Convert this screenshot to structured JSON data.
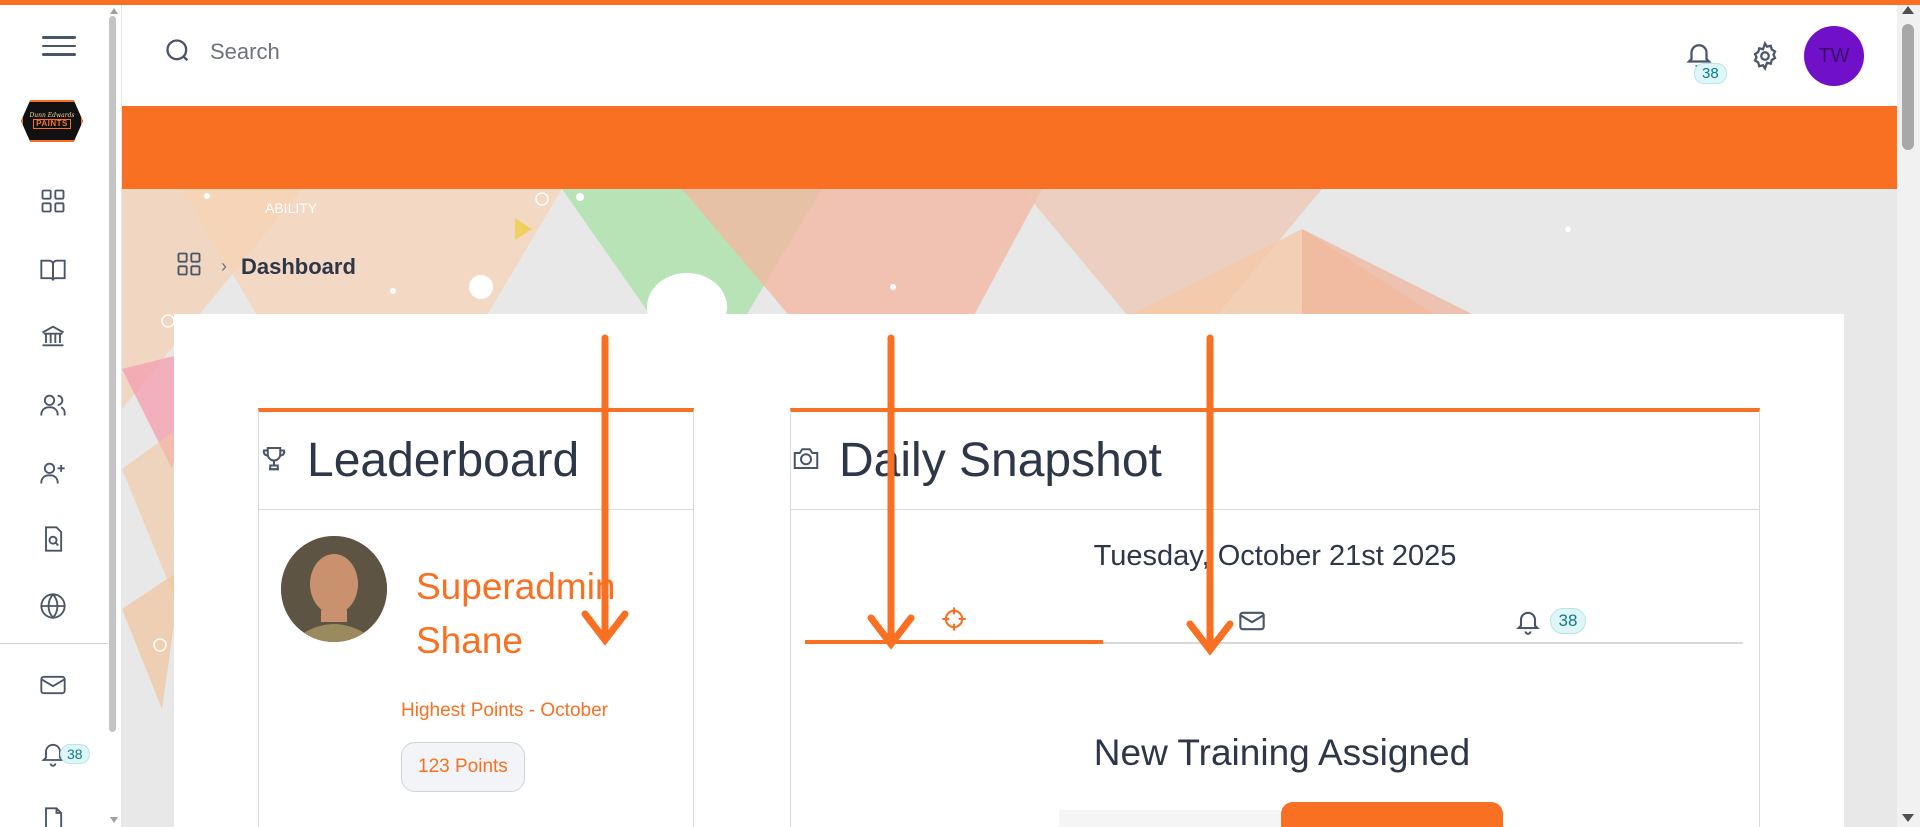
{
  "header": {
    "search_placeholder": "Search",
    "notification_count": "38",
    "avatar_initials": "TW"
  },
  "sidebar": {
    "logo_line1": "Dunn Edwards",
    "logo_line2": "PAINTS",
    "notification_count": "38",
    "items": [
      {
        "icon": "grid-icon"
      },
      {
        "icon": "book-icon"
      },
      {
        "icon": "bank-icon"
      },
      {
        "icon": "users-icon"
      },
      {
        "icon": "user-plus-icon"
      },
      {
        "icon": "file-search-icon"
      },
      {
        "icon": "globe-icon"
      },
      {
        "icon": "mail-icon"
      },
      {
        "icon": "bell-icon"
      },
      {
        "icon": "document-icon"
      }
    ]
  },
  "banner": {
    "decor_text": "ABILITY"
  },
  "breadcrumb": {
    "title": "Dashboard"
  },
  "leaderboard": {
    "title": "Leaderboard",
    "name": "Superadmin Shane",
    "subtitle": "Highest Points - October",
    "points": "123 Points"
  },
  "daily_snapshot": {
    "title": "Daily Snapshot",
    "date": "Tuesday, October 21st 2025",
    "tabs": [
      {
        "icon": "target-icon",
        "active": true
      },
      {
        "icon": "mail-icon",
        "active": false
      },
      {
        "icon": "bell-icon",
        "active": false,
        "badge": "38"
      }
    ],
    "section_heading": "New Training Assigned"
  },
  "colors": {
    "accent": "#f97022",
    "text": "#2d3748",
    "avatar": "#7010c8",
    "badge_bg": "#dff6f8",
    "badge_text": "#0e7c86"
  }
}
